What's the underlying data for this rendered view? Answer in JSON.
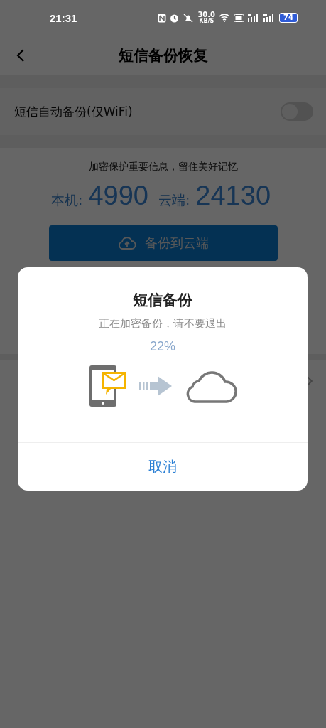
{
  "status_bar": {
    "time": "21:31",
    "net_speed": "30.0",
    "net_unit": "KB/S",
    "battery": "74"
  },
  "header": {
    "title": "短信备份恢复"
  },
  "auto_backup": {
    "label": "短信自动备份(仅WiFi)",
    "on": false
  },
  "summary": {
    "slogan": "加密保护重要信息，留住美好记忆",
    "local_label": "本机:",
    "local_count": "4990",
    "cloud_label": "云端:",
    "cloud_count": "24130",
    "button": "备份到云端"
  },
  "dialog": {
    "title": "短信备份",
    "message": "正在加密备份，请不要退出",
    "percent": "22%",
    "cancel": "取消"
  }
}
